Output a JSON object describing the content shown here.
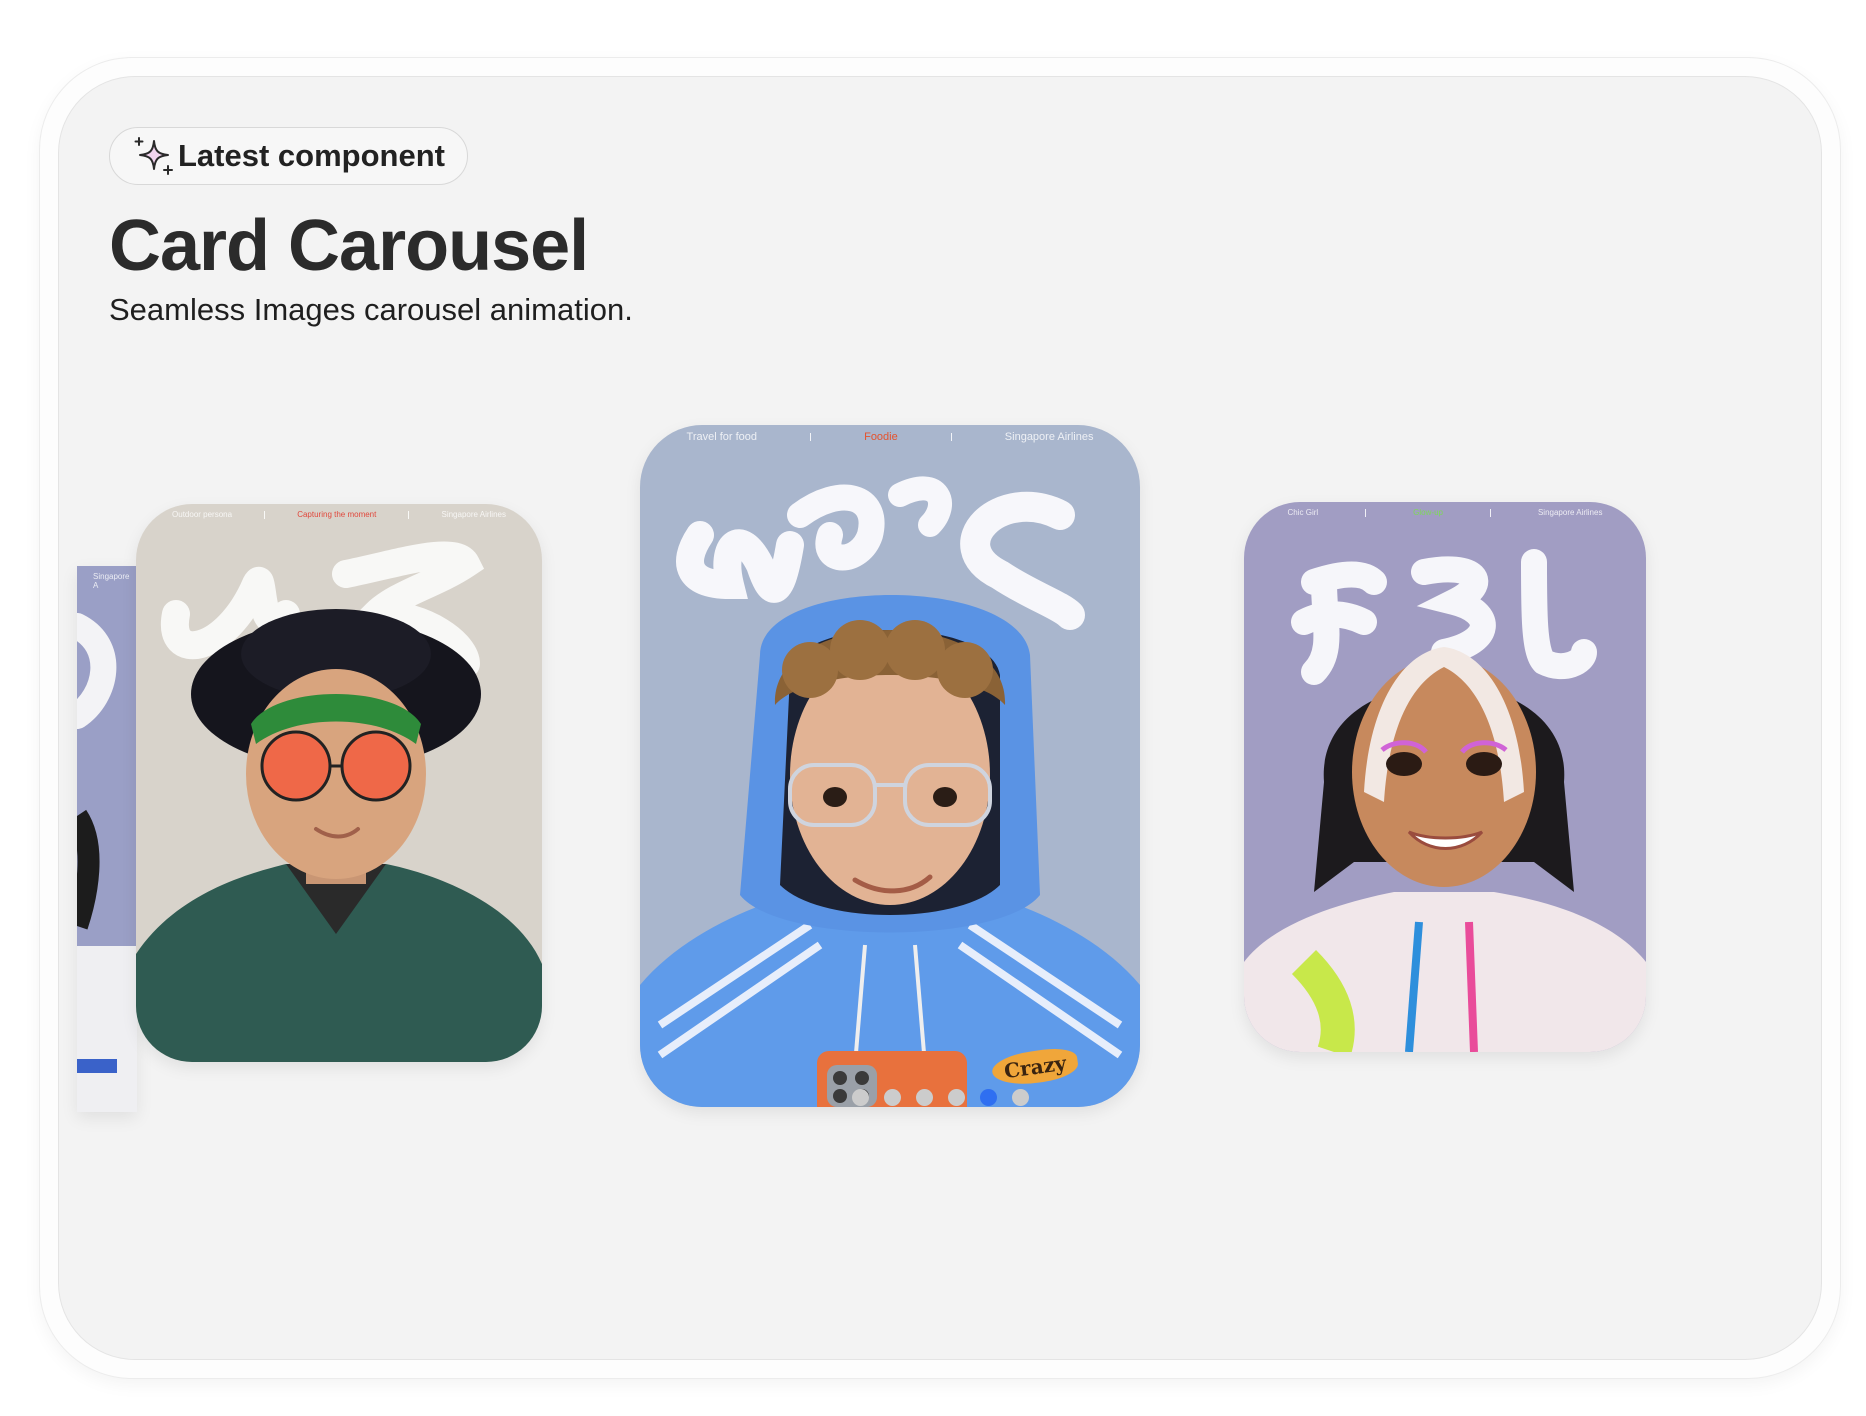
{
  "badge": {
    "icon": "sparkle-icon",
    "label": "Latest component"
  },
  "title": "Card Carousel",
  "subtitle": "Seamless Images carousel animation.",
  "cards": [
    {
      "id": "far-left",
      "topbar": [
        "Singapore A"
      ],
      "name": "",
      "bg": "#9aa0c8"
    },
    {
      "id": "left",
      "topbar": [
        "Outdoor persona",
        "Capturing the moment",
        "Singapore Airlines"
      ],
      "name": "AJ",
      "bg": "#d6d1c9",
      "highlight": "#e0483c"
    },
    {
      "id": "center",
      "topbar": [
        "Travel for food",
        "Foodie",
        "Singapore Airlines"
      ],
      "name": "Marc",
      "bg": "#a9b7cf",
      "highlight": "#e5532e"
    },
    {
      "id": "right",
      "topbar": [
        "Chic Girl",
        "Glow-up",
        "Singapore Airlines"
      ],
      "name": "FEL",
      "bg": "#a09cc4",
      "highlight": "#7ed957"
    }
  ],
  "carousel": {
    "total": 6,
    "active_index": 4,
    "dot_color": "#cccccc",
    "active_dot_color": "#2f6ff1"
  },
  "badges": {
    "crazy": "Crazy"
  }
}
